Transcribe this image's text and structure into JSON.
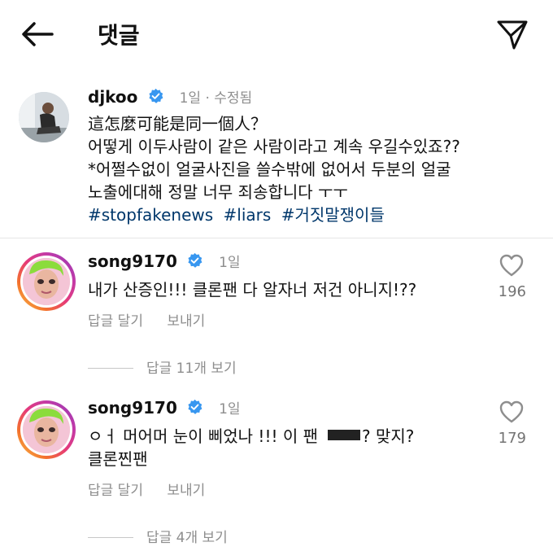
{
  "header": {
    "title": "댓글"
  },
  "post": {
    "username": "djkoo",
    "meta": "1일 · 수정됨",
    "lines": [
      "這怎麼可能是同一個人？",
      "어떻게 이두사람이 같은 사람이라고 계속 우길수있죠??",
      "*어쩔수없이 얼굴사진을 쓸수밖에 없어서 두분의 얼굴",
      "노출에대해 정말 너무 죄송합니다 ㅜㅜ"
    ],
    "hashtags": [
      "#stopfakenews",
      "#liars",
      "#거짓말쟁이들"
    ]
  },
  "comments": [
    {
      "username": "song9170",
      "time": "1일",
      "text_line1": "내가 산증인!!! 클론팬 다 알자너 저건 아니지!??",
      "likes": "196",
      "reply_label": "답글 달기",
      "send_label": "보내기",
      "view_replies": "답글 11개 보기"
    },
    {
      "username": "song9170",
      "time": "1일",
      "text_line1_a": "ㅇㅓ 머어머 눈이 삐었나 !!! 이 팬",
      "text_line1_b": "? 맞지?",
      "text_line2": "클론찐팬",
      "likes": "179",
      "reply_label": "답글 달기",
      "send_label": "보내기",
      "view_replies": "답글 4개 보기"
    }
  ],
  "colors": {
    "verified": "#3897f0",
    "hashtag": "#00376b",
    "meta": "#8e8e8e"
  }
}
